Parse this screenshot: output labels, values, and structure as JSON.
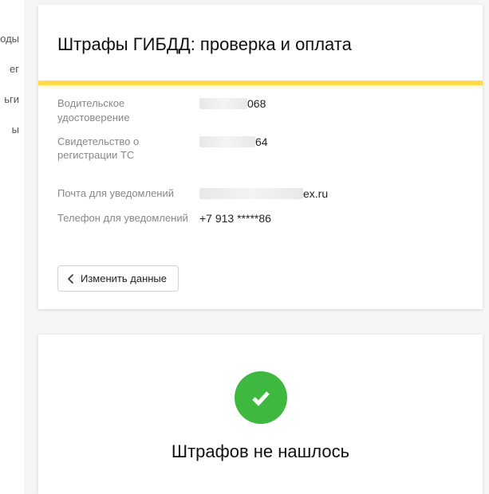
{
  "sidebar": {
    "items": [
      "оды",
      "ег",
      "ьги",
      "ы"
    ]
  },
  "page": {
    "title": "Штрафы ГИБДД: проверка и оплата"
  },
  "info": {
    "license": {
      "label": "Водительское удостоверение",
      "value_visible": "068"
    },
    "registration": {
      "label": "Свидетельство о регистрации ТС",
      "value_visible": "64"
    },
    "email": {
      "label": "Почта для уведомлений",
      "value_visible": "ex.ru"
    },
    "phone": {
      "label": "Телефон для уведомлений",
      "value": "+7 913 *****86"
    }
  },
  "buttons": {
    "edit": "Изменить данные"
  },
  "result": {
    "title": "Штрафов не нашлось"
  },
  "colors": {
    "accent": "#ffdb4d",
    "success": "#3fb83f"
  }
}
